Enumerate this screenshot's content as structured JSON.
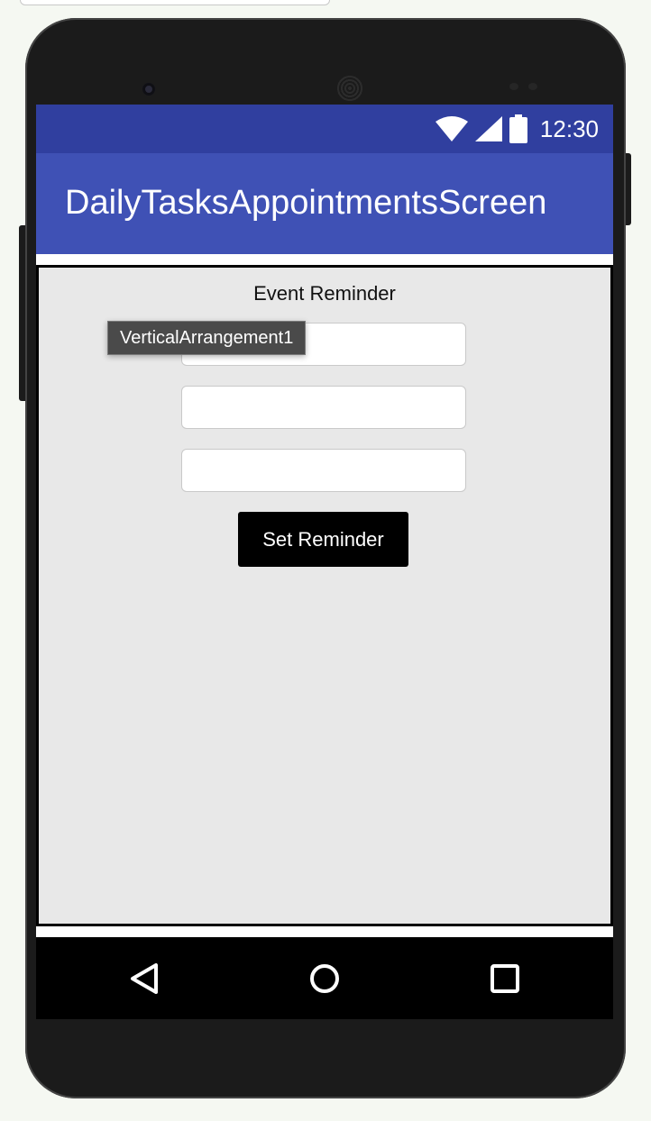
{
  "device": {
    "status_bar": {
      "time": "12:30",
      "icons": [
        "wifi-icon",
        "signal-icon",
        "battery-icon"
      ]
    },
    "app_bar": {
      "title": "DailyTasksAppointmentsScreen"
    },
    "colors": {
      "status_bar": "#303f9f",
      "app_bar": "#3f51b5",
      "content_bg": "#e8e8e8",
      "button_bg": "#000000"
    }
  },
  "form": {
    "label": "Event Reminder",
    "inputs": [
      {
        "value": "",
        "placeholder": ""
      },
      {
        "value": "",
        "placeholder": ""
      },
      {
        "value": "",
        "placeholder": ""
      }
    ],
    "button_label": "Set Reminder"
  },
  "tooltip": {
    "text": "VerticalArrangement1"
  },
  "nav_bar": {
    "buttons": [
      "back-icon",
      "home-icon",
      "recents-icon"
    ]
  }
}
